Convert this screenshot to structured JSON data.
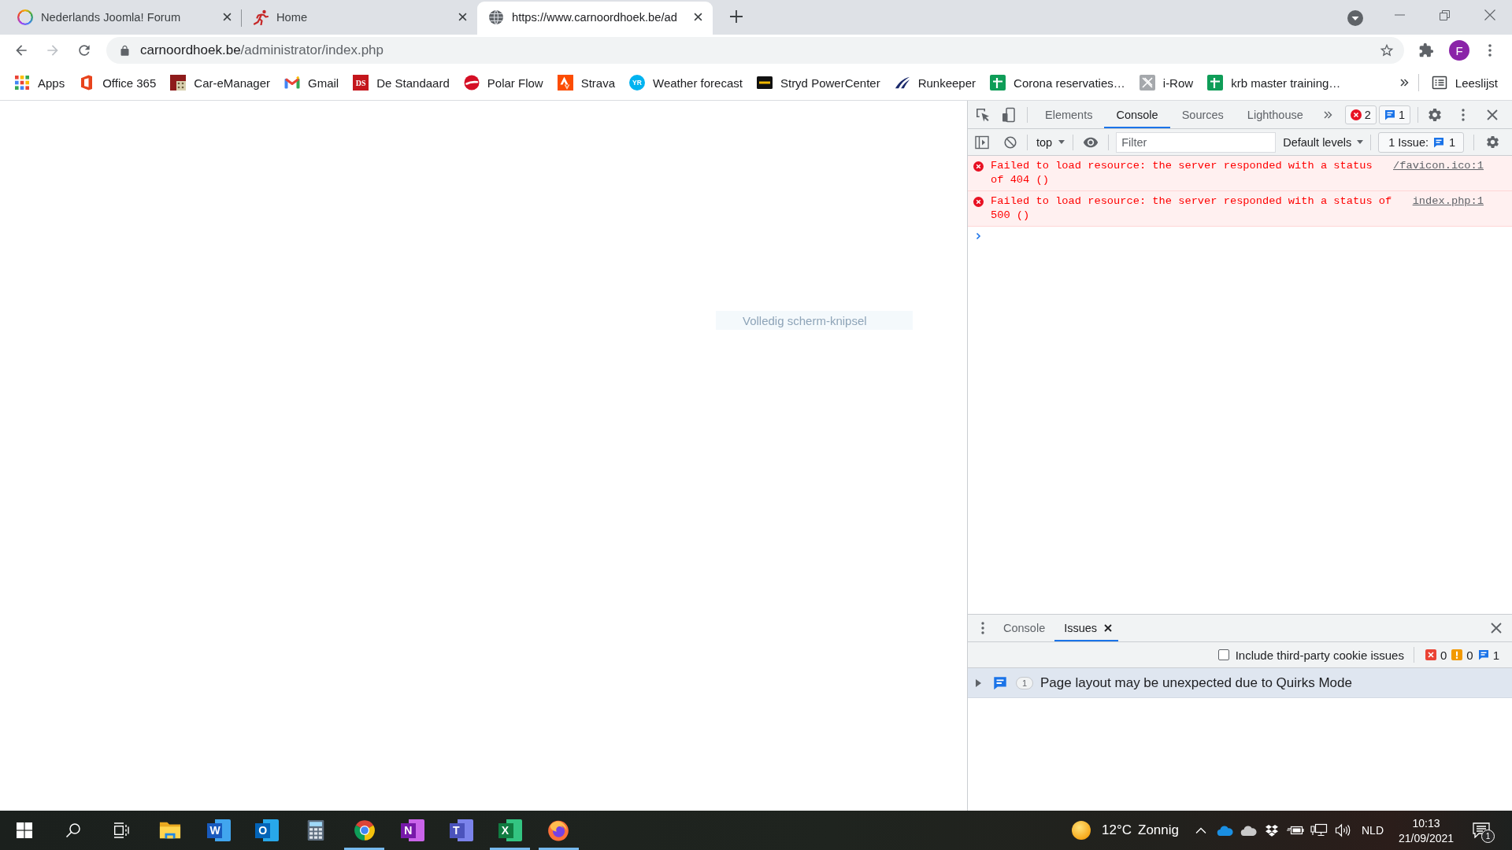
{
  "browser_tabs": [
    {
      "kind": "ring",
      "title": "Nederlands Joomla! Forum",
      "selected": false
    },
    {
      "kind": "runner",
      "title": "Home",
      "selected": false
    },
    {
      "kind": "globe",
      "title": "https://www.carnoordhoek.be/ad",
      "selected": true
    }
  ],
  "toolbar": {
    "back_enabled": true,
    "forward_enabled": false,
    "url_host": "carnoordhoek.be",
    "url_path": "/administrator/index.php",
    "profile_initial": "F"
  },
  "bookmarks": [
    {
      "kind": "apps",
      "label": "Apps"
    },
    {
      "kind": "office",
      "label": "Office 365"
    },
    {
      "kind": "car",
      "label": "Car-eManager"
    },
    {
      "kind": "gmail",
      "label": "Gmail"
    },
    {
      "kind": "ds",
      "logo_text": "DS",
      "label": "De Standaard"
    },
    {
      "kind": "polar",
      "label": "Polar Flow"
    },
    {
      "kind": "strava",
      "label": "Strava"
    },
    {
      "kind": "yr",
      "logo_text": "YR",
      "label": "Weather forecast"
    },
    {
      "kind": "stryd",
      "label": "Stryd PowerCenter"
    },
    {
      "kind": "runkeeper",
      "label": "Runkeeper"
    },
    {
      "kind": "sheet",
      "label": "Corona reservaties…"
    },
    {
      "kind": "irow",
      "label": "i-Row"
    },
    {
      "kind": "sheet",
      "label": "krb master training…"
    }
  ],
  "reading_list": {
    "label": "Leeslijst"
  },
  "snip_notice": "Volledig scherm-knipsel",
  "devtools": {
    "tabs": [
      {
        "label": "Elements",
        "selected": false
      },
      {
        "label": "Console",
        "selected": true
      },
      {
        "label": "Sources",
        "selected": false
      },
      {
        "label": "Lighthouse",
        "selected": false
      }
    ],
    "error_count": "2",
    "message_count": "1",
    "console_toolbar": {
      "context": "top",
      "filter_placeholder": "Filter",
      "levels": "Default levels",
      "issues_label": "1 Issue:",
      "issues_count": "1"
    },
    "messages": [
      {
        "kind": "error",
        "text": "Failed to load resource: the server responded with a status of 404 ()",
        "source": "/favicon.ico:1"
      },
      {
        "kind": "error",
        "text": "Failed to load resource: the server responded with a status of 500 ()",
        "source": "index.php:1"
      }
    ],
    "drawer": {
      "tabs": [
        {
          "label": "Console",
          "selected": false,
          "closable": false
        },
        {
          "label": "Issues",
          "selected": true,
          "closable": true
        }
      ],
      "third_party_cookies": {
        "label": "Include third-party cookie issues",
        "checked": false
      },
      "counts": [
        {
          "kind": "error",
          "count": "0"
        },
        {
          "kind": "warning",
          "count": "0"
        },
        {
          "kind": "info",
          "count": "1"
        }
      ],
      "issues": [
        {
          "title": "Page layout may be unexpected due to Quirks Mode",
          "count": "1",
          "expanded": false
        }
      ]
    }
  },
  "taskbar": {
    "apps": [
      {
        "kind": "folder",
        "running": false
      },
      {
        "kind": "word",
        "letter": "W",
        "running": false
      },
      {
        "kind": "outlook",
        "letter": "O",
        "running": false
      },
      {
        "kind": "calculator",
        "running": false
      },
      {
        "kind": "chrome",
        "running": true
      },
      {
        "kind": "onenote",
        "letter": "N",
        "running": false
      },
      {
        "kind": "teams",
        "letter": "T",
        "running": false
      },
      {
        "kind": "excel",
        "letter": "X",
        "running": true
      },
      {
        "kind": "firefox",
        "running": true
      }
    ],
    "weather": {
      "temperature": "12°C",
      "condition": "Zonnig"
    },
    "language": "NLD",
    "time": "10:13",
    "date": "21/09/2021",
    "notification_count": "1"
  }
}
